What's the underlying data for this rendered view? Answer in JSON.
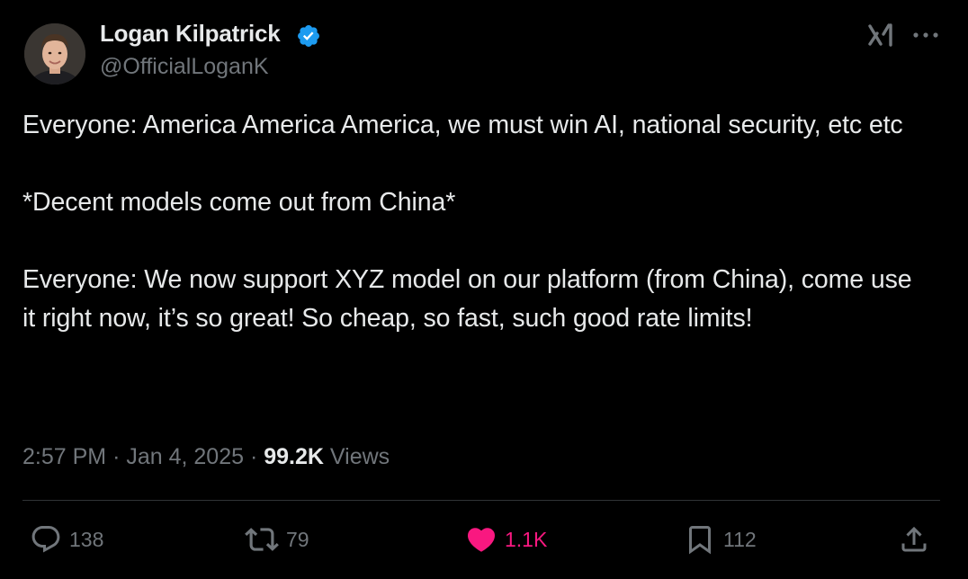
{
  "author": {
    "name": "Logan Kilpatrick",
    "handle": "@OfficialLoganK",
    "verified": true,
    "avatar": "profile-photo"
  },
  "tweet": {
    "paragraphs": [
      "Everyone: America America America, we must win AI, national security, etc etc",
      "*Decent models come out from China*",
      "Everyone: We now support XYZ model on our platform (from China), come use it right now, it’s so great! So cheap, so fast, such good rate limits!"
    ]
  },
  "meta": {
    "time": "2:57 PM",
    "separator": "·",
    "date": "Jan 4, 2025",
    "views_count": "99.2K",
    "views_label": "Views"
  },
  "actions": {
    "replies": "138",
    "reposts": "79",
    "likes": "1.1K",
    "bookmarks": "112"
  },
  "icons": {
    "header": [
      "grok-icon",
      "more-icon"
    ],
    "actions": [
      "reply-icon",
      "repost-icon",
      "heart-icon",
      "bookmark-icon",
      "share-icon"
    ]
  },
  "colors": {
    "background": "#000000",
    "text": "#e7e9ea",
    "secondary": "#71767b",
    "verified": "#1d9bf0",
    "like": "#f91880",
    "divider": "#2f3336"
  }
}
